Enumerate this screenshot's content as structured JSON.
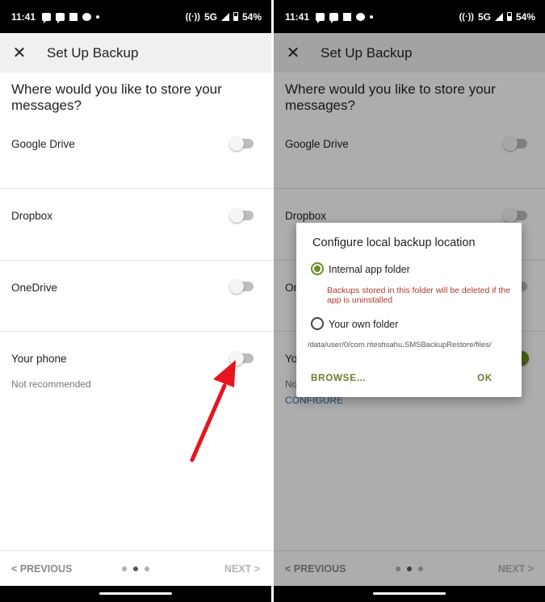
{
  "status_bar": {
    "time": "11:41",
    "network": "5G",
    "battery": "54%"
  },
  "app_bar": {
    "close_icon": "close-icon",
    "title": "Set Up Backup"
  },
  "question": "Where would you like to store your messages?",
  "options": [
    {
      "label": "Google Drive",
      "enabled": false
    },
    {
      "label": "Dropbox",
      "enabled": false
    },
    {
      "label": "OneDrive",
      "enabled": false
    },
    {
      "label": "Your phone",
      "sublabel": "Not recommended",
      "configure_link": "CONFIGURE",
      "enabled_left": false,
      "enabled_right": true
    }
  ],
  "bottom_nav": {
    "previous": "< PREVIOUS",
    "next": "NEXT >",
    "pages": 3,
    "current_page": 2
  },
  "dialog": {
    "title": "Configure local backup location",
    "option_internal": "Internal app folder",
    "warning": "Backups stored in this folder will be deleted if the app is uninstalled",
    "option_own": "Your own folder",
    "path": "/data/user/0/com.riteshsahu.SMSBackupRestore/files/",
    "browse_button": "BROWSE…",
    "ok_button": "OK",
    "selected": "internal"
  },
  "colors": {
    "accent": "#6b8e23",
    "warning": "#b03a2e",
    "annotation_arrow": "#e8141e"
  }
}
